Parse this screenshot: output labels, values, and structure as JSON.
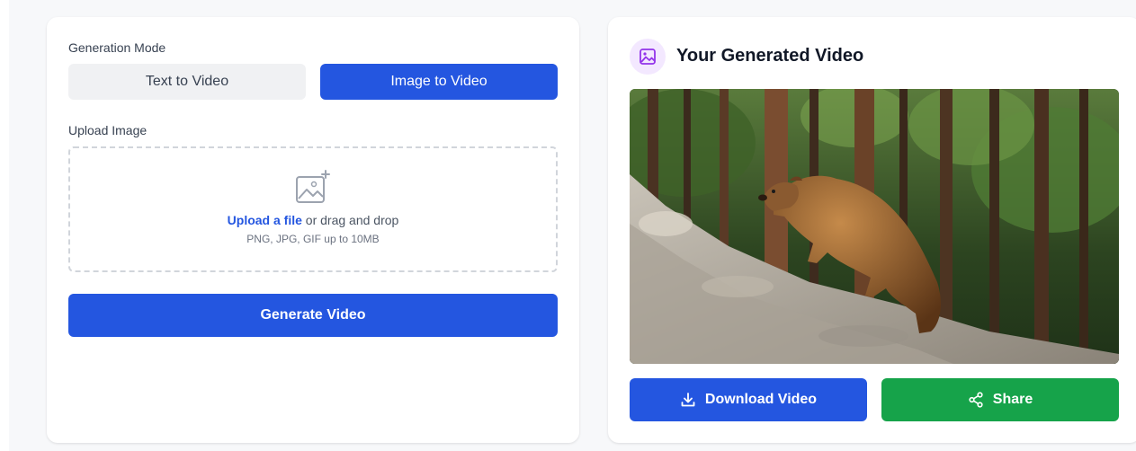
{
  "generator": {
    "mode_label": "Generation Mode",
    "modes": [
      {
        "label": "Text to Video",
        "active": false
      },
      {
        "label": "Image to Video",
        "active": true
      }
    ],
    "upload_label": "Upload Image",
    "dropzone": {
      "icon": "image-add-icon",
      "link_text": "Upload a file",
      "drag_text": "or drag and drop",
      "hint": "PNG, JPG, GIF up to 10MB"
    },
    "generate_label": "Generate Video"
  },
  "result": {
    "icon": "image-icon",
    "title": "Your Generated Video",
    "preview": {
      "subject": "Brown bear climbing a rocky slope in a pine forest"
    },
    "download_label": "Download Video",
    "download_icon": "download-icon",
    "share_label": "Share",
    "share_icon": "share-icon"
  },
  "colors": {
    "primary": "#2456e0",
    "success": "#16a34a",
    "icon_bg": "#f3e8ff",
    "icon_fg": "#9333ea"
  }
}
